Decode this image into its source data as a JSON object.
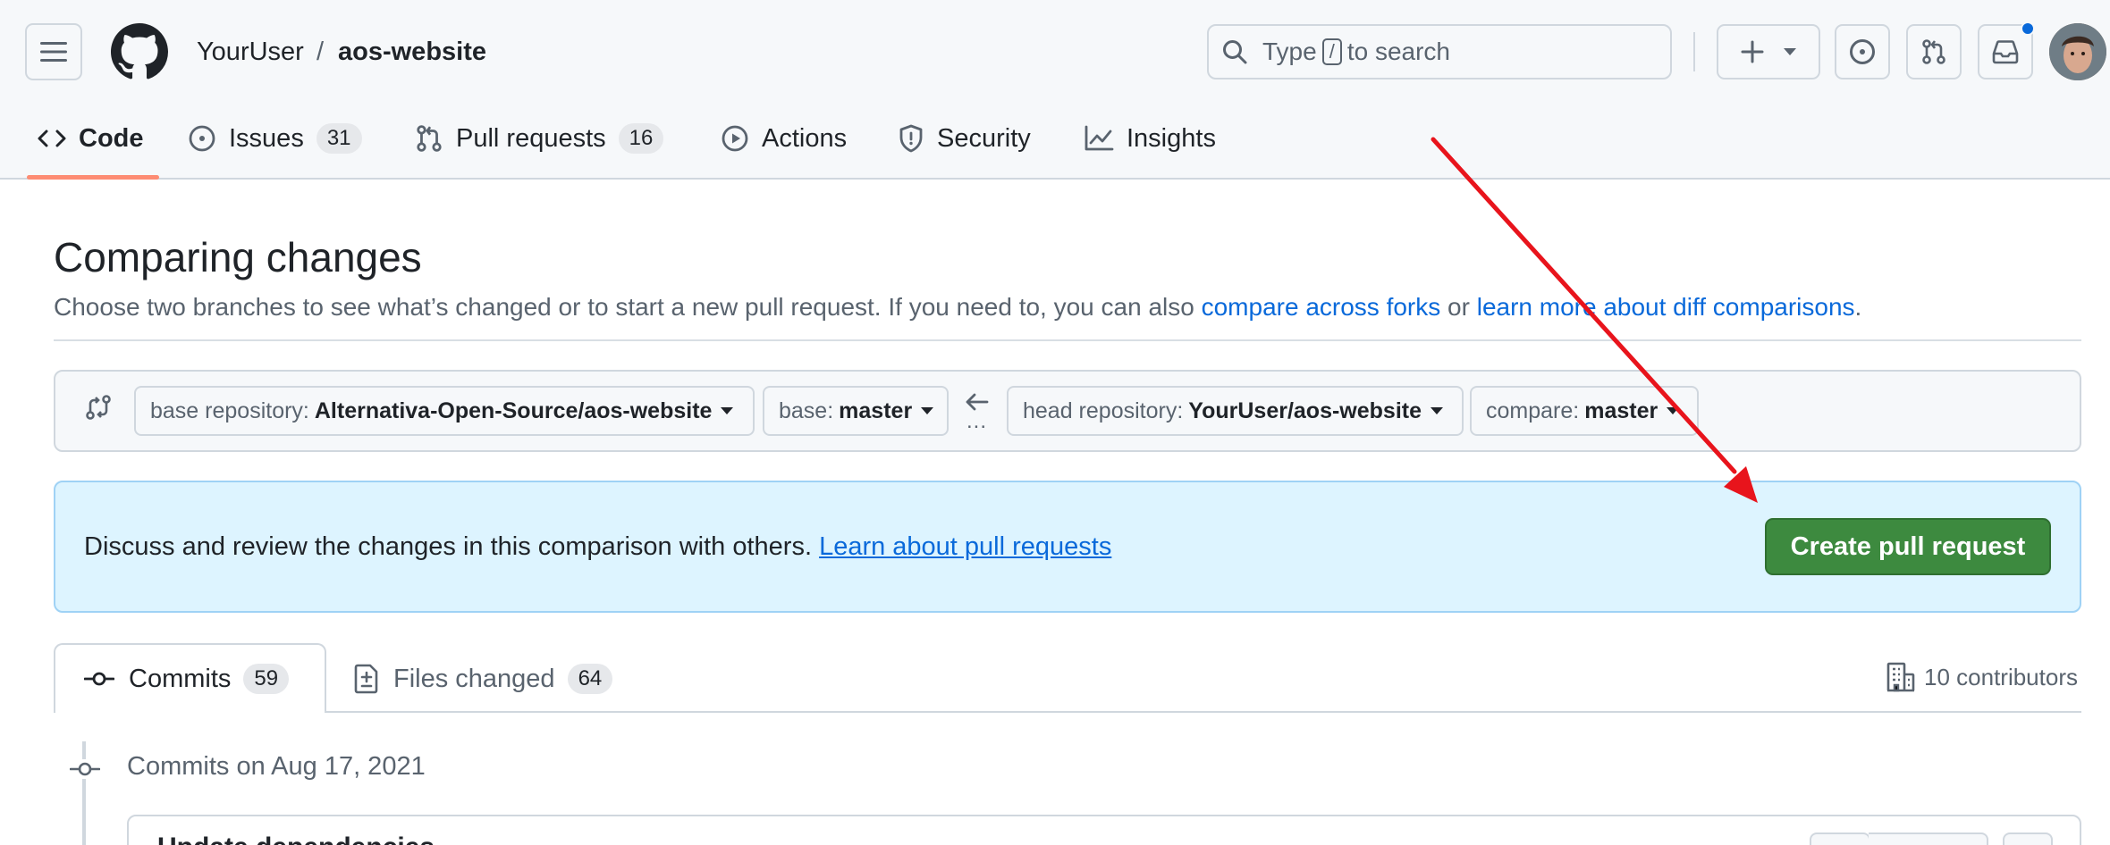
{
  "header": {
    "owner": "YourUser",
    "separator": "/",
    "repo": "aos-website",
    "search": {
      "pre": "Type",
      "key": "/",
      "post": "to search"
    }
  },
  "nav": {
    "code": "Code",
    "issues": {
      "label": "Issues",
      "count": "31"
    },
    "pulls": {
      "label": "Pull requests",
      "count": "16"
    },
    "actions": "Actions",
    "security": "Security",
    "insights": "Insights"
  },
  "main": {
    "title": "Comparing changes",
    "description": {
      "text1": "Choose two branches to see what’s changed or to start a new pull request. If you need to, you can also ",
      "link1": "compare across forks",
      "text2": " or ",
      "link2": "learn more about diff comparisons",
      "text3": "."
    }
  },
  "range": {
    "base_repo": {
      "label": "base repository:",
      "value": "Alternativa-Open-Source/aos-website"
    },
    "base": {
      "label": "base:",
      "value": "master"
    },
    "dots": "...",
    "head_repo": {
      "label": "head repository:",
      "value": "YourUser/aos-website"
    },
    "compare": {
      "label": "compare:",
      "value": "master"
    }
  },
  "flash": {
    "text": "Discuss and review the changes in this comparison with others. ",
    "link": "Learn about pull requests",
    "button": "Create pull request"
  },
  "tabs": {
    "commits": {
      "label": "Commits",
      "count": "59"
    },
    "files": {
      "label": "Files changed",
      "count": "64"
    },
    "contributors": "10 contributors"
  },
  "commits": {
    "date_heading": "Commits on Aug 17, 2021",
    "first_title": "Update dependencies"
  },
  "colors": {
    "accent_link": "#0969da",
    "primary_button": "#3d8a3f",
    "flash_bg": "#ddf4ff",
    "annotation_arrow": "#e8141c",
    "underline": "#fd8c73"
  }
}
